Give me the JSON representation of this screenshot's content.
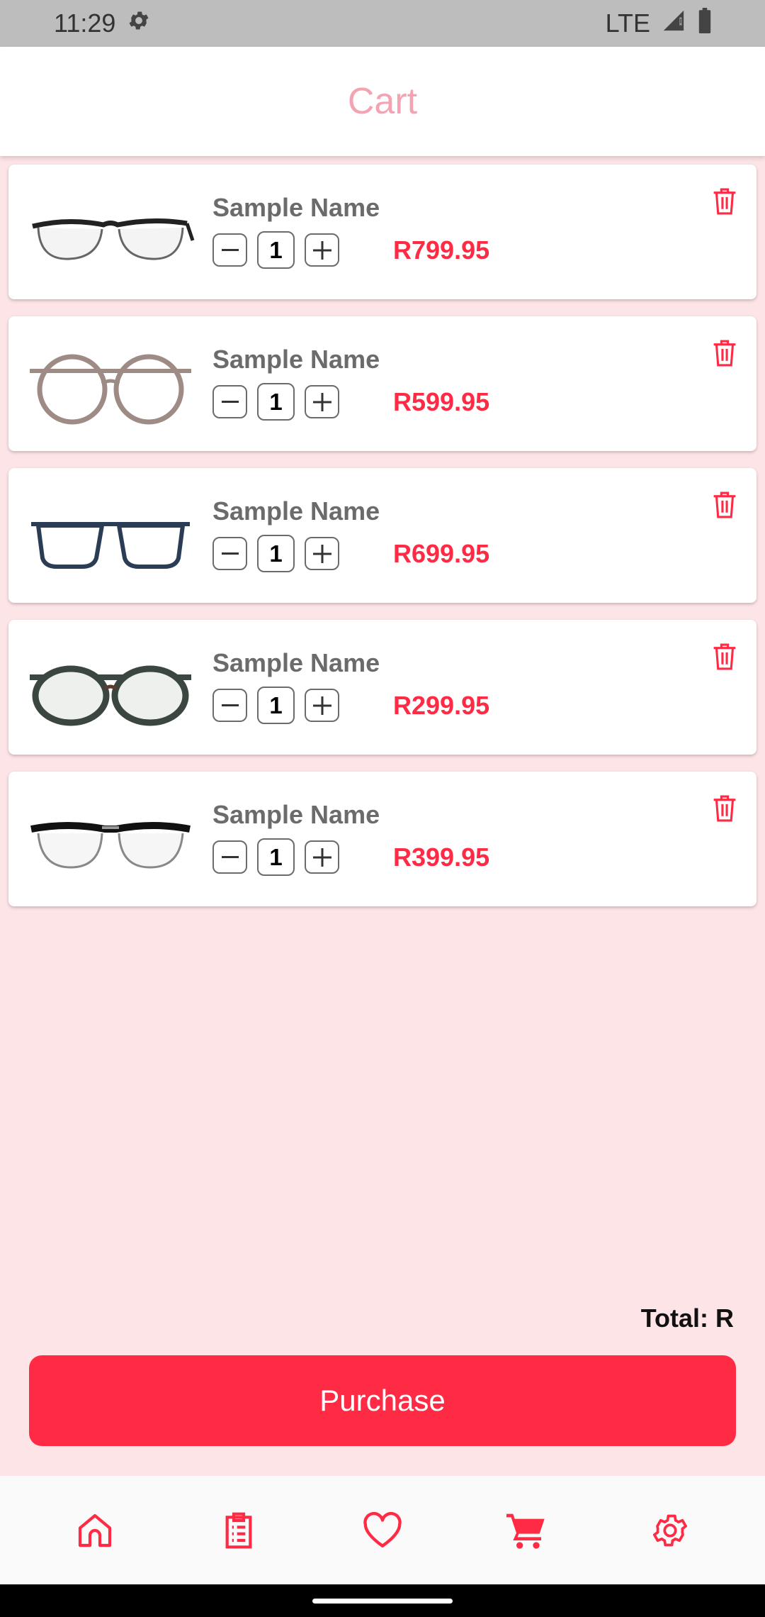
{
  "status_bar": {
    "time": "11:29",
    "network": "LTE",
    "icons": [
      "settings-icon",
      "signal-icon",
      "battery-icon"
    ]
  },
  "app_bar": {
    "title": "Cart"
  },
  "cart": {
    "items": [
      {
        "name": "Sample Name",
        "quantity": "1",
        "price": "R799.95",
        "frame_color": "#222222"
      },
      {
        "name": "Sample Name",
        "quantity": "1",
        "price": "R599.95",
        "frame_color": "#9e8b85"
      },
      {
        "name": "Sample Name",
        "quantity": "1",
        "price": "R699.95",
        "frame_color": "#2b3d55"
      },
      {
        "name": "Sample Name",
        "quantity": "1",
        "price": "R299.95",
        "frame_color": "#3b4640"
      },
      {
        "name": "Sample Name",
        "quantity": "1",
        "price": "R399.95",
        "frame_color": "#111111"
      }
    ],
    "total_label": "Total: R",
    "purchase_label": "Purchase"
  },
  "bottom_nav": {
    "items": [
      {
        "icon": "home-icon",
        "active": false
      },
      {
        "icon": "orders-icon",
        "active": false
      },
      {
        "icon": "heart-icon",
        "active": false
      },
      {
        "icon": "cart-icon",
        "active": true
      },
      {
        "icon": "gear-icon",
        "active": false
      }
    ]
  },
  "colors": {
    "accent": "#ff2a44",
    "title": "#f4a3b3",
    "background": "#fde4e7"
  }
}
